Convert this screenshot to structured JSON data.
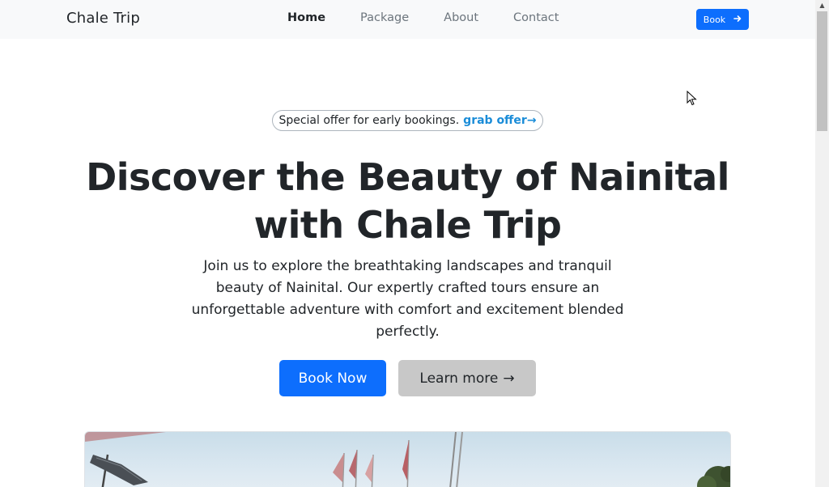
{
  "nav": {
    "brand": "Chale Trip",
    "links": [
      {
        "label": "Home",
        "active": true
      },
      {
        "label": "Package",
        "active": false
      },
      {
        "label": "About",
        "active": false
      },
      {
        "label": "Contact",
        "active": false
      }
    ],
    "book_label": "Book",
    "book_icon": "arrow-right-icon"
  },
  "hero": {
    "offer_text": "Special offer for early bookings.",
    "offer_link": "grab offer",
    "offer_arrow": "→",
    "title_line1": "Discover the Beauty of Nainital",
    "title_line2": "with Chale Trip",
    "description": "Join us to explore the breathtaking landscapes and tranquil beauty of Nainital. Our expertly crafted tours ensure an unforgettable adventure with comfort and excitement blended perfectly.",
    "primary_button": "Book Now",
    "secondary_button": "Learn more",
    "secondary_arrow": "→"
  },
  "colors": {
    "primary": "#0d6efd",
    "navbar_bg": "#f8f9fa",
    "text": "#212529",
    "muted": "#6c757d",
    "offer_link": "#1a8cd8",
    "secondary_bg": "#c8c8c8"
  }
}
